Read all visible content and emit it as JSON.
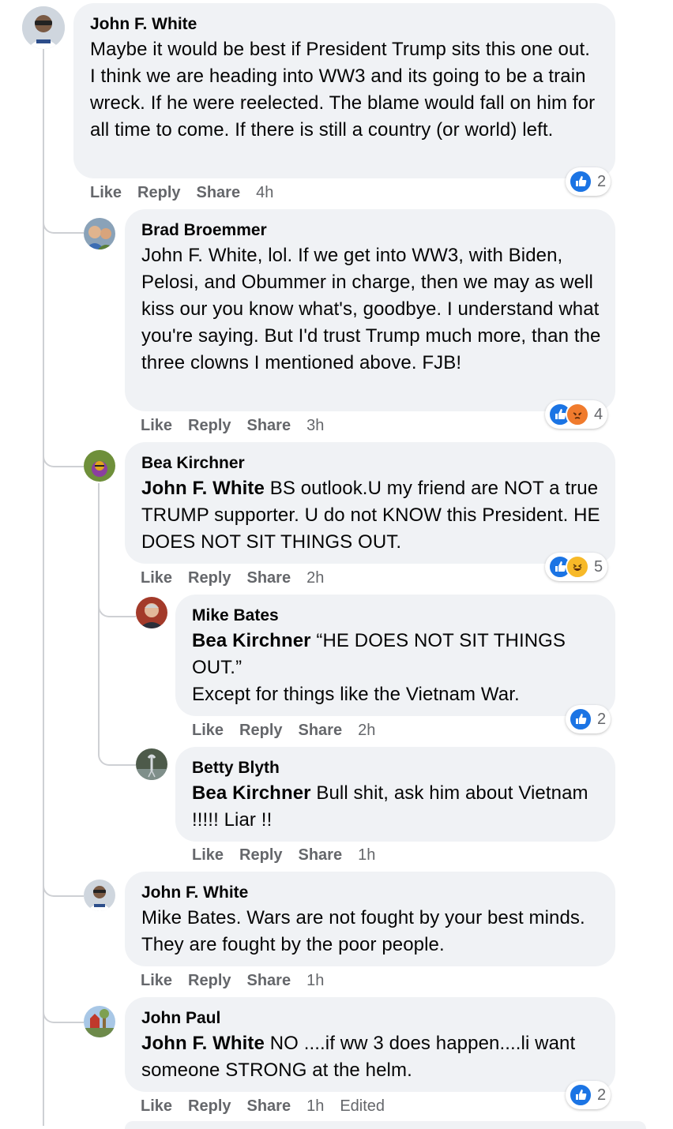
{
  "comments": [
    {
      "author": "John F. White",
      "text": "Maybe it would be best if President Trump sits this one out. I think we are heading into WW3 and its going to be a train wreck. If he were reelected. The blame would fall on him for all time to come. If there is still a country (or world) left.",
      "like": "Like",
      "reply": "Reply",
      "share": "Share",
      "time": "4h",
      "reactions_count": "2"
    },
    {
      "author": "Brad Broemmer",
      "text": "John F. White, lol. If we get into WW3, with Biden, Pelosi, and Obummer in charge, then we may as well kiss our you know what's, goodbye. I understand what you're saying. But I'd trust Trump much more, than the three clowns I mentioned above. FJB!",
      "like": "Like",
      "reply": "Reply",
      "share": "Share",
      "time": "3h",
      "reactions_count": "4"
    },
    {
      "author": "Bea Kirchner",
      "mention": "John F. White",
      "text": " BS outlook.U my friend are NOT a true TRUMP supporter. U do not KNOW this President. HE DOES NOT SIT THINGS OUT.",
      "like": "Like",
      "reply": "Reply",
      "share": "Share",
      "time": "2h",
      "reactions_count": "5"
    },
    {
      "author": "Mike Bates",
      "mention": "Bea Kirchner",
      "text": " “HE DOES NOT SIT THINGS OUT.”\nExcept for things like the Vietnam War.",
      "like": "Like",
      "reply": "Reply",
      "share": "Share",
      "time": "2h",
      "reactions_count": "2"
    },
    {
      "author": "Betty Blyth",
      "mention": "Bea Kirchner",
      "text": " Bull shit, ask him about Vietnam !!!!! Liar !!",
      "like": "Like",
      "reply": "Reply",
      "share": "Share",
      "time": "1h"
    },
    {
      "author": "John F. White",
      "text": "Mike Bates. Wars are not fought by your best minds. They are fought by the poor people.",
      "like": "Like",
      "reply": "Reply",
      "share": "Share",
      "time": "1h"
    },
    {
      "author": "John Paul",
      "mention": "John F. White",
      "text": " NO ....if ww 3 does happen....li want someone STRONG at the helm.",
      "like": "Like",
      "reply": "Reply",
      "share": "Share",
      "time": "1h",
      "edited": "Edited",
      "reactions_count": "2"
    }
  ],
  "colors": {
    "bubble": "#f0f2f5",
    "muted": "#65676b",
    "like": "#1b74e4",
    "angry": "#f07b2d",
    "haha": "#f7b928",
    "line": "#ced0d4"
  }
}
